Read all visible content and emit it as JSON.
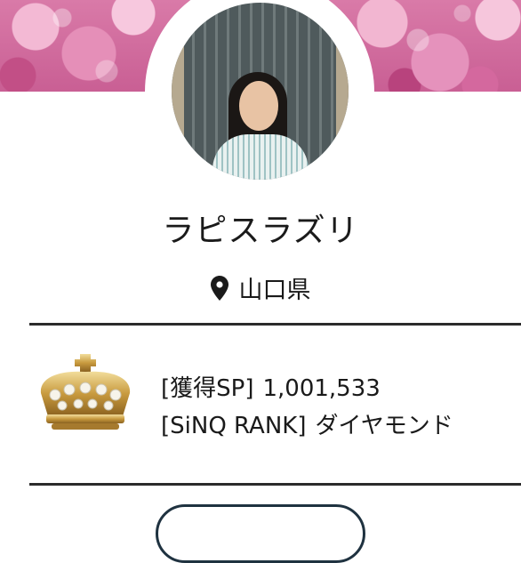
{
  "profile": {
    "name": "ラピスラズリ",
    "location": "山口県"
  },
  "rank_card": {
    "sp_label": "[獲得SP]",
    "sp_value": "1,001,533",
    "rank_label": "[SiNQ RANK]",
    "rank_value": "ダイヤモンド"
  },
  "icons": {
    "location": "map-pin-icon",
    "rank": "crown-icon"
  },
  "colors": {
    "accent": "#1f3240",
    "divider": "#2b2b2b",
    "cover": "#d97aa8"
  }
}
